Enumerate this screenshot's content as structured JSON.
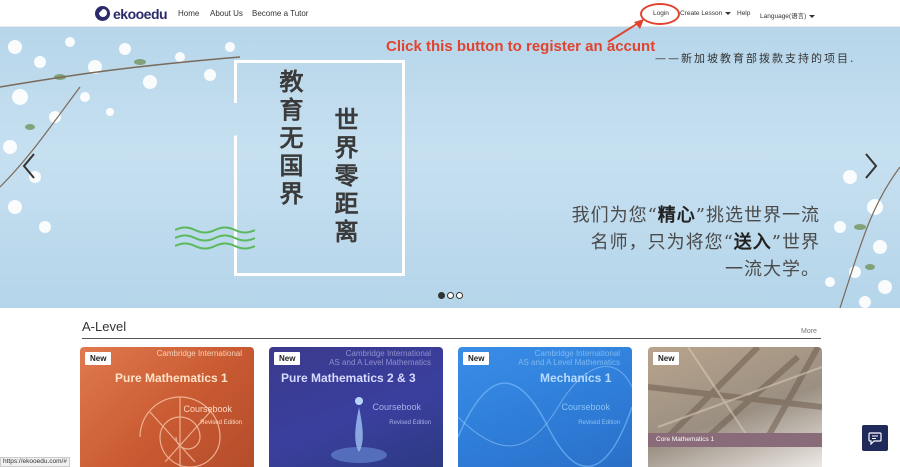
{
  "nav": {
    "logo_text": "ekooedu",
    "links": [
      "Home",
      "About Us",
      "Become a Tutor"
    ],
    "login": "Login",
    "create_lesson": "Create Lesson",
    "help": "Help",
    "language": "Language(语言)"
  },
  "annotation": {
    "text": "Click this button to register an accunt",
    "color": "#e0432f"
  },
  "hero": {
    "tagline": "——新加坡教育部拨款支持的项目.",
    "vertical_left": "教育无国界",
    "vertical_right": "世界零距离",
    "right_line_1_a": "我们为您“",
    "right_line_1_b": "精心",
    "right_line_1_c": "”挑选世界一流",
    "right_line_2_a": "名师，只为将您“",
    "right_line_2_b": "送入",
    "right_line_2_c": "”世界",
    "right_line_3": "一流大学。",
    "slides": 3,
    "active_slide": 1
  },
  "section": {
    "title": "A-Level",
    "more": "More"
  },
  "cards": [
    {
      "badge": "New",
      "publisher": "Cambridge International",
      "series": "",
      "title": "Pure Mathematics 1",
      "subtitle": "Coursebook",
      "edition": "Revised Edition"
    },
    {
      "badge": "New",
      "publisher": "Cambridge International",
      "series": "AS and A Level Mathematics",
      "title": "Pure Mathematics 2 & 3",
      "subtitle": "Coursebook",
      "edition": "Revised Edition"
    },
    {
      "badge": "New",
      "publisher": "Cambridge International",
      "series": "AS and A Level Mathematics",
      "title": "Mechanics 1",
      "subtitle": "Coursebook",
      "edition": "Revised Edition"
    },
    {
      "badge": "New",
      "title": "Core Mathematics 1"
    }
  ],
  "status_bar": {
    "url": "https://ekooedu.com/#"
  },
  "colors": {
    "brand": "#2b2a6b",
    "accent": "#e0432f",
    "chat": "#1f2a5a"
  },
  "icons": [
    "chevron-left-icon",
    "chevron-right-icon",
    "chat-icon",
    "caret-down-icon"
  ]
}
